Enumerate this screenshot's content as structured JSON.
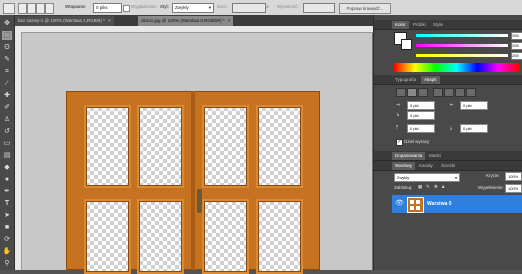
{
  "options_bar": {
    "feather_label": "Wtapianie:",
    "feather_value": "0 piks",
    "antialias_label": "Wygładzanie",
    "style_label": "Styl:",
    "style_value": "Zwykły",
    "width_label": "Szer.:",
    "height_label": "Wysokość:",
    "refine_label": "Popraw krawędź..."
  },
  "document_tabs": [
    {
      "title": "bez nazwy-1 @ 100% (Warstwa 1,RGB/8) *",
      "active": false,
      "close": "×"
    },
    {
      "title": "okno1.jpg @ 100% (Warstwa 0,RGB/8#) *",
      "active": true,
      "close": "×"
    }
  ],
  "color_panel": {
    "tabs": [
      "Kolor",
      "Próbki",
      "Style"
    ],
    "values": [
      "255",
      "255",
      "255"
    ]
  },
  "character_panel": {
    "tabs": [
      "Typografia",
      "Akapit"
    ],
    "indent_left": "0 pkt",
    "indent_right": "0 pkt",
    "indent_first": "0 pkt",
    "space_before": "0 pkt",
    "space_after": "0 pkt",
    "hyphenate_label": "Dziel wyrazy"
  },
  "adjust_panel": {
    "tabs": [
      "Dopasowania",
      "Maski"
    ]
  },
  "layers_panel": {
    "tabs": [
      "Warstwy",
      "Kanały",
      "Ścieżki"
    ],
    "blend_mode": "Zwykły",
    "opacity_label": "Krycie:",
    "opacity_value": "100%",
    "lock_label": "Zablokuj:",
    "fill_label": "Wypełnienie:",
    "fill_value": "100%",
    "layers": [
      {
        "name": "Warstwa 0",
        "selected": true
      }
    ]
  },
  "colors": {
    "accent": "#2d7fe0",
    "wood": "#c67321"
  }
}
